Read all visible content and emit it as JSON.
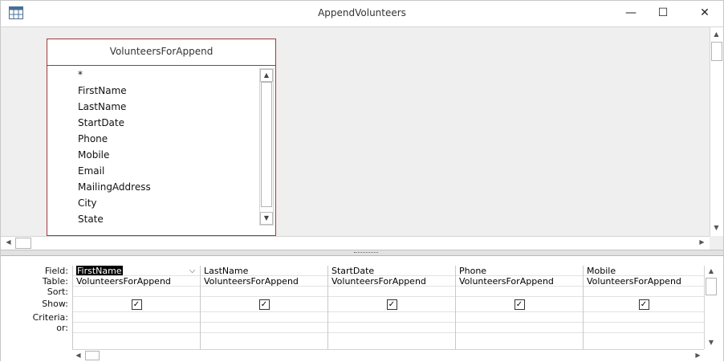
{
  "window": {
    "title": "AppendVolunteers",
    "minimize_glyph": "—",
    "maximize_glyph": "☐",
    "close_glyph": "✕"
  },
  "field_list": {
    "table_name": "VolunteersForAppend",
    "items": [
      "*",
      "FirstName",
      "LastName",
      "StartDate",
      "Phone",
      "Mobile",
      "Email",
      "MailingAddress",
      "City",
      "State"
    ]
  },
  "design_grid": {
    "row_labels": [
      "Field:",
      "Table:",
      "Sort:",
      "Show:",
      "Criteria:",
      "or:"
    ],
    "columns": [
      {
        "field": "FirstName",
        "table": "VolunteersForAppend",
        "sort": "",
        "show": true,
        "criteria": "",
        "or": ""
      },
      {
        "field": "LastName",
        "table": "VolunteersForAppend",
        "sort": "",
        "show": true,
        "criteria": "",
        "or": ""
      },
      {
        "field": "StartDate",
        "table": "VolunteersForAppend",
        "sort": "",
        "show": true,
        "criteria": "",
        "or": ""
      },
      {
        "field": "Phone",
        "table": "VolunteersForAppend",
        "sort": "",
        "show": true,
        "criteria": "",
        "or": ""
      },
      {
        "field": "Mobile",
        "table": "VolunteersForAppend",
        "sort": "",
        "show": true,
        "criteria": "",
        "or": ""
      }
    ]
  },
  "icons": {
    "app": "query-design-icon",
    "dropdown": "chevron-down-icon",
    "checkbox": "checkmark-icon"
  }
}
